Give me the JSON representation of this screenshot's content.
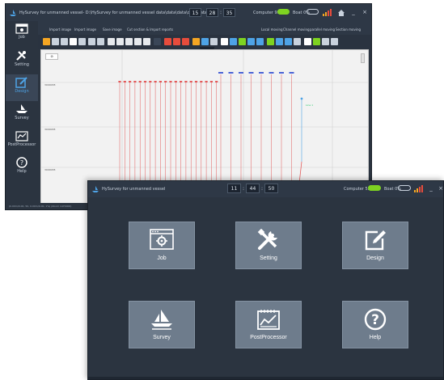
{
  "back_window": {
    "title": "HySurvey for unmanned vessel- D:\\HySurvey for unmanned vessel data\\data\\data\\data\\data.tohz",
    "clock": {
      "h": "15",
      "m": "28",
      "s": "35"
    },
    "computer_status": "Computer 99%",
    "boat_status": "Boat 0%",
    "sidebar": [
      {
        "label": "Job",
        "icon": "job-icon"
      },
      {
        "label": "Setting",
        "icon": "wrench-icon"
      },
      {
        "label": "Design",
        "icon": "edit-icon",
        "active": true
      },
      {
        "label": "Survey",
        "icon": "boat-icon"
      },
      {
        "label": "PostProcessor",
        "icon": "chart-icon"
      },
      {
        "label": "Help",
        "icon": "help-icon"
      }
    ],
    "menu_left": [
      "Import image",
      "Import image",
      "Save image",
      "Cut section & Import reports"
    ],
    "menu_right": [
      "Local moving",
      "Channel moving",
      "parallel moving",
      "Section moving"
    ],
    "y_labels": [
      "3000038",
      "3000038",
      "3000038"
    ],
    "status_row": "(0.00m/0.00, 50, 0.00m/0.00, 1%)  (Zoom  1470000)",
    "line_label": "Line 1"
  },
  "front_window": {
    "title": "HySurvey for unmanned vessel",
    "clock": {
      "h": "11",
      "m": "44",
      "s": "50"
    },
    "computer_status": "Computer 53%",
    "boat_status": "Boat 0%",
    "tiles": [
      {
        "label": "Job",
        "icon": "job-icon"
      },
      {
        "label": "Setting",
        "icon": "wrench-icon"
      },
      {
        "label": "Design",
        "icon": "edit-icon"
      },
      {
        "label": "Survey",
        "icon": "boat-icon"
      },
      {
        "label": "PostProcessor",
        "icon": "chart-icon"
      },
      {
        "label": "Help",
        "icon": "help-icon"
      }
    ]
  },
  "colors": {
    "toggle_green": "#7ed321",
    "signal_orange": "#f5a623",
    "survey_line_red": "#e35a5a",
    "tile_bg": "#6e7c8c"
  }
}
